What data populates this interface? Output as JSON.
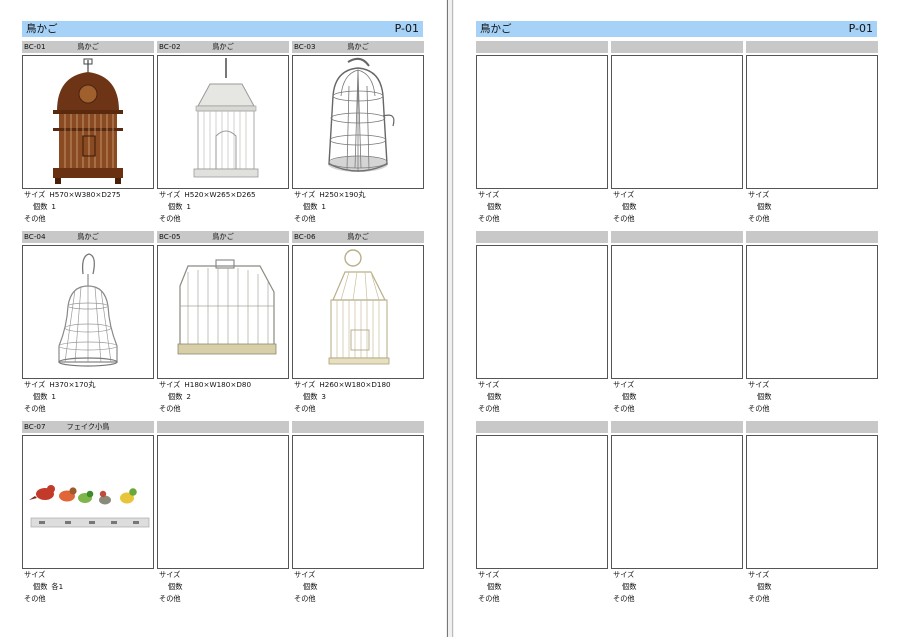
{
  "left_page": {
    "title": "鳥かご",
    "page_no": "P-01",
    "items": [
      {
        "code": "BC-01",
        "name": "鳥かご",
        "size_label": "サイズ",
        "size_value": "H570×W380×D275",
        "qty_label": "個数",
        "qty_value": "1",
        "other_label": "その他"
      },
      {
        "code": "BC-02",
        "name": "鳥かご",
        "size_label": "サイズ",
        "size_value": "H520×W265×D265",
        "qty_label": "個数",
        "qty_value": "1",
        "other_label": "その他"
      },
      {
        "code": "BC-03",
        "name": "鳥かご",
        "size_label": "サイズ",
        "size_value": "H250×190丸",
        "qty_label": "個数",
        "qty_value": "1",
        "other_label": "その他"
      },
      {
        "code": "BC-04",
        "name": "鳥かご",
        "size_label": "サイズ",
        "size_value": "H370×170丸",
        "qty_label": "個数",
        "qty_value": "1",
        "other_label": "その他"
      },
      {
        "code": "BC-05",
        "name": "鳥かご",
        "size_label": "サイズ",
        "size_value": "H180×W180×D80",
        "qty_label": "個数",
        "qty_value": "2",
        "other_label": "その他"
      },
      {
        "code": "BC-06",
        "name": "鳥かご",
        "size_label": "サイズ",
        "size_value": "H260×W180×D180",
        "qty_label": "個数",
        "qty_value": "3",
        "other_label": "その他"
      },
      {
        "code": "BC-07",
        "name": "フェイク小鳥",
        "size_label": "サイズ",
        "size_value": "",
        "qty_label": "個数",
        "qty_value": "各1",
        "other_label": "その他"
      },
      {
        "code": "",
        "name": "",
        "size_label": "サイズ",
        "size_value": "",
        "qty_label": "個数",
        "qty_value": "",
        "other_label": "その他"
      },
      {
        "code": "",
        "name": "",
        "size_label": "サイズ",
        "size_value": "",
        "qty_label": "個数",
        "qty_value": "",
        "other_label": "その他"
      }
    ]
  },
  "right_page": {
    "title": "鳥かご",
    "page_no": "P-01",
    "items": [
      {
        "size_label": "サイズ",
        "qty_label": "個数",
        "other_label": "その他"
      },
      {
        "size_label": "サイズ",
        "qty_label": "個数",
        "other_label": "その他"
      },
      {
        "size_label": "サイズ",
        "qty_label": "個数",
        "other_label": "その他"
      },
      {
        "size_label": "サイズ",
        "qty_label": "個数",
        "other_label": "その他"
      },
      {
        "size_label": "サイズ",
        "qty_label": "個数",
        "other_label": "その他"
      },
      {
        "size_label": "サイズ",
        "qty_label": "個数",
        "other_label": "その他"
      },
      {
        "size_label": "サイズ",
        "qty_label": "個数",
        "other_label": "その他"
      },
      {
        "size_label": "サイズ",
        "qty_label": "個数",
        "other_label": "その他"
      },
      {
        "size_label": "サイズ",
        "qty_label": "個数",
        "other_label": "その他"
      }
    ]
  }
}
